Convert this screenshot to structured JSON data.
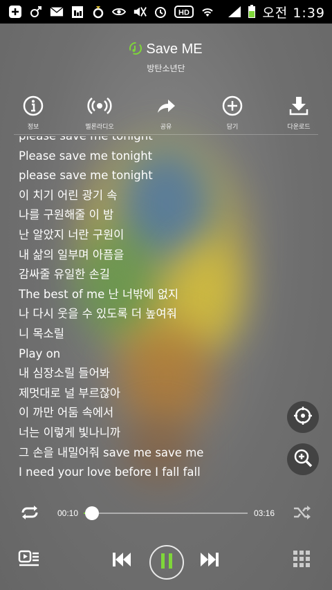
{
  "status_bar": {
    "time": "오전 1:39",
    "icons": [
      "add-icon",
      "gender-icon",
      "mail-icon",
      "calendar-icon",
      "ring-icon",
      "eye-icon",
      "mute-icon",
      "alarm-icon",
      "hd-icon",
      "wifi-icon",
      "signal-icon",
      "battery-icon"
    ]
  },
  "song": {
    "title": "Save ME",
    "artist": "방탄소년단"
  },
  "actions": [
    {
      "label": "정보",
      "icon": "info-icon"
    },
    {
      "label": "멜론라디오",
      "icon": "radio-icon"
    },
    {
      "label": "공유",
      "icon": "share-icon"
    },
    {
      "label": "담기",
      "icon": "add-circle-icon"
    },
    {
      "label": "다운로드",
      "icon": "download-icon"
    }
  ],
  "lyrics": [
    "please save me tonight",
    "Please save me tonight",
    "please save me tonight",
    "이 치기 어린 광기 속",
    "나를 구원해줄 이 밤",
    "난 알았지 너란 구원이",
    "내 삶의 일부며 아픔을",
    "감싸줄 유일한 손길",
    "The best of me 난 너밖에 없지",
    "나 다시 웃을 수 있도록 더 높여줘",
    "니 목소릴",
    "Play on",
    "내 심장소릴 들어봐",
    "제멋대로 널 부르잖아",
    "이 까만 어둠 속에서",
    "너는 이렇게 빛나니까",
    "그 손을 내밀어줘 save me save me",
    "I need your love before I fall fall"
  ],
  "player": {
    "elapsed": "00:10",
    "duration": "03:16",
    "progress_fraction": 0.051,
    "accent_color": "#7fd63a"
  }
}
